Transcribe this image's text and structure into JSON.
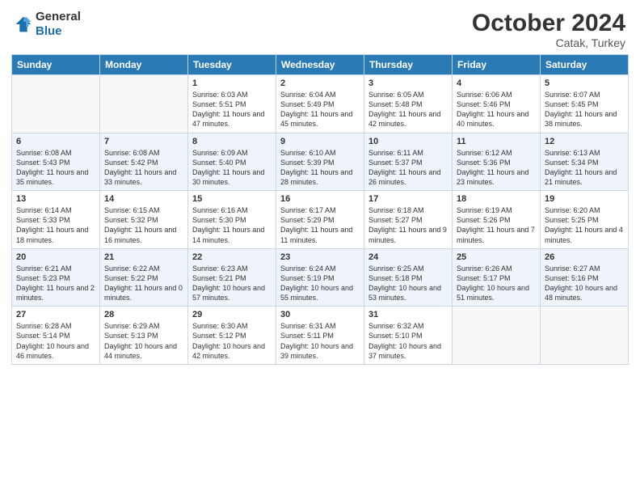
{
  "header": {
    "logo_general": "General",
    "logo_blue": "Blue",
    "month_title": "October 2024",
    "location": "Catak, Turkey"
  },
  "weekdays": [
    "Sunday",
    "Monday",
    "Tuesday",
    "Wednesday",
    "Thursday",
    "Friday",
    "Saturday"
  ],
  "weeks": [
    [
      {
        "day": "",
        "info": ""
      },
      {
        "day": "",
        "info": ""
      },
      {
        "day": "1",
        "info": "Sunrise: 6:03 AM\nSunset: 5:51 PM\nDaylight: 11 hours and 47 minutes."
      },
      {
        "day": "2",
        "info": "Sunrise: 6:04 AM\nSunset: 5:49 PM\nDaylight: 11 hours and 45 minutes."
      },
      {
        "day": "3",
        "info": "Sunrise: 6:05 AM\nSunset: 5:48 PM\nDaylight: 11 hours and 42 minutes."
      },
      {
        "day": "4",
        "info": "Sunrise: 6:06 AM\nSunset: 5:46 PM\nDaylight: 11 hours and 40 minutes."
      },
      {
        "day": "5",
        "info": "Sunrise: 6:07 AM\nSunset: 5:45 PM\nDaylight: 11 hours and 38 minutes."
      }
    ],
    [
      {
        "day": "6",
        "info": "Sunrise: 6:08 AM\nSunset: 5:43 PM\nDaylight: 11 hours and 35 minutes."
      },
      {
        "day": "7",
        "info": "Sunrise: 6:08 AM\nSunset: 5:42 PM\nDaylight: 11 hours and 33 minutes."
      },
      {
        "day": "8",
        "info": "Sunrise: 6:09 AM\nSunset: 5:40 PM\nDaylight: 11 hours and 30 minutes."
      },
      {
        "day": "9",
        "info": "Sunrise: 6:10 AM\nSunset: 5:39 PM\nDaylight: 11 hours and 28 minutes."
      },
      {
        "day": "10",
        "info": "Sunrise: 6:11 AM\nSunset: 5:37 PM\nDaylight: 11 hours and 26 minutes."
      },
      {
        "day": "11",
        "info": "Sunrise: 6:12 AM\nSunset: 5:36 PM\nDaylight: 11 hours and 23 minutes."
      },
      {
        "day": "12",
        "info": "Sunrise: 6:13 AM\nSunset: 5:34 PM\nDaylight: 11 hours and 21 minutes."
      }
    ],
    [
      {
        "day": "13",
        "info": "Sunrise: 6:14 AM\nSunset: 5:33 PM\nDaylight: 11 hours and 18 minutes."
      },
      {
        "day": "14",
        "info": "Sunrise: 6:15 AM\nSunset: 5:32 PM\nDaylight: 11 hours and 16 minutes."
      },
      {
        "day": "15",
        "info": "Sunrise: 6:16 AM\nSunset: 5:30 PM\nDaylight: 11 hours and 14 minutes."
      },
      {
        "day": "16",
        "info": "Sunrise: 6:17 AM\nSunset: 5:29 PM\nDaylight: 11 hours and 11 minutes."
      },
      {
        "day": "17",
        "info": "Sunrise: 6:18 AM\nSunset: 5:27 PM\nDaylight: 11 hours and 9 minutes."
      },
      {
        "day": "18",
        "info": "Sunrise: 6:19 AM\nSunset: 5:26 PM\nDaylight: 11 hours and 7 minutes."
      },
      {
        "day": "19",
        "info": "Sunrise: 6:20 AM\nSunset: 5:25 PM\nDaylight: 11 hours and 4 minutes."
      }
    ],
    [
      {
        "day": "20",
        "info": "Sunrise: 6:21 AM\nSunset: 5:23 PM\nDaylight: 11 hours and 2 minutes."
      },
      {
        "day": "21",
        "info": "Sunrise: 6:22 AM\nSunset: 5:22 PM\nDaylight: 11 hours and 0 minutes."
      },
      {
        "day": "22",
        "info": "Sunrise: 6:23 AM\nSunset: 5:21 PM\nDaylight: 10 hours and 57 minutes."
      },
      {
        "day": "23",
        "info": "Sunrise: 6:24 AM\nSunset: 5:19 PM\nDaylight: 10 hours and 55 minutes."
      },
      {
        "day": "24",
        "info": "Sunrise: 6:25 AM\nSunset: 5:18 PM\nDaylight: 10 hours and 53 minutes."
      },
      {
        "day": "25",
        "info": "Sunrise: 6:26 AM\nSunset: 5:17 PM\nDaylight: 10 hours and 51 minutes."
      },
      {
        "day": "26",
        "info": "Sunrise: 6:27 AM\nSunset: 5:16 PM\nDaylight: 10 hours and 48 minutes."
      }
    ],
    [
      {
        "day": "27",
        "info": "Sunrise: 6:28 AM\nSunset: 5:14 PM\nDaylight: 10 hours and 46 minutes."
      },
      {
        "day": "28",
        "info": "Sunrise: 6:29 AM\nSunset: 5:13 PM\nDaylight: 10 hours and 44 minutes."
      },
      {
        "day": "29",
        "info": "Sunrise: 6:30 AM\nSunset: 5:12 PM\nDaylight: 10 hours and 42 minutes."
      },
      {
        "day": "30",
        "info": "Sunrise: 6:31 AM\nSunset: 5:11 PM\nDaylight: 10 hours and 39 minutes."
      },
      {
        "day": "31",
        "info": "Sunrise: 6:32 AM\nSunset: 5:10 PM\nDaylight: 10 hours and 37 minutes."
      },
      {
        "day": "",
        "info": ""
      },
      {
        "day": "",
        "info": ""
      }
    ]
  ]
}
